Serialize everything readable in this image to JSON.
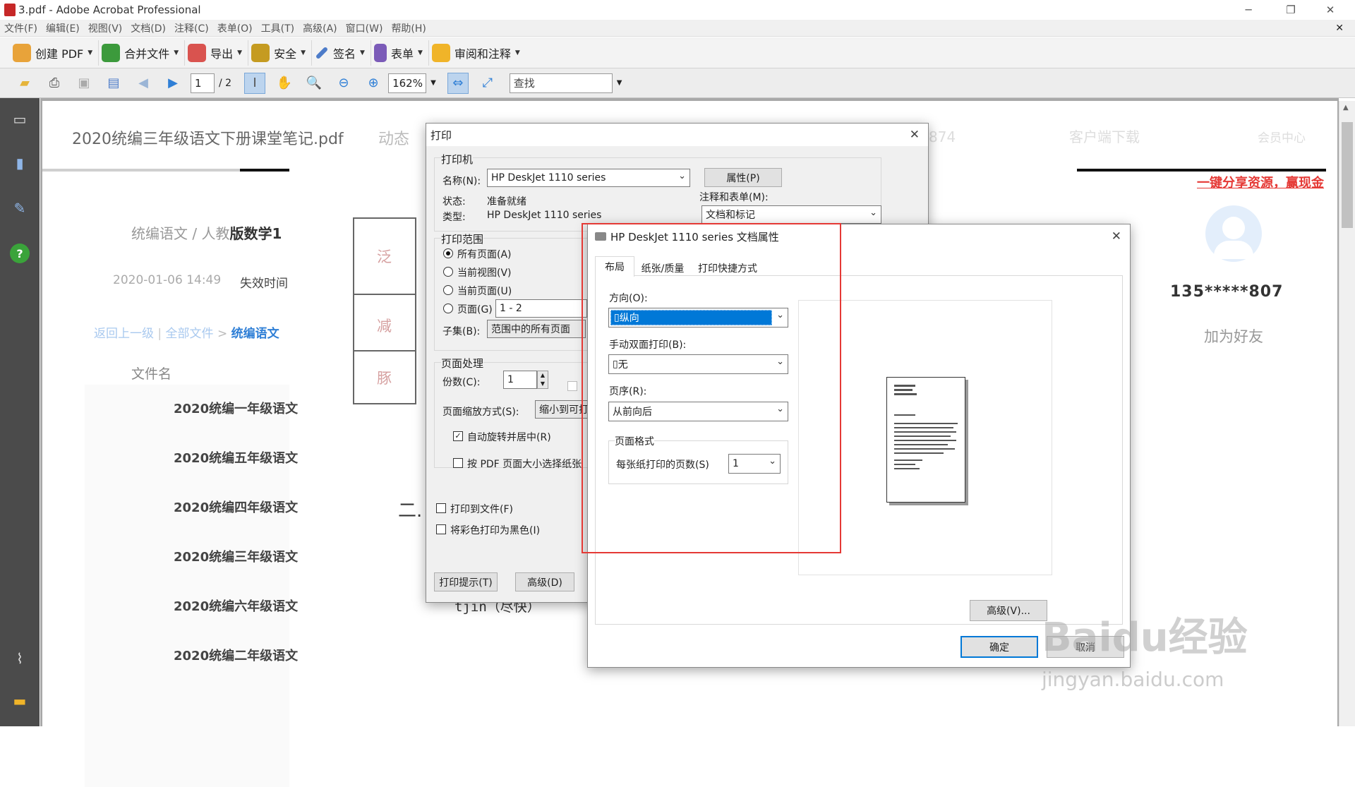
{
  "window": {
    "title": "3.pdf - Adobe Acrobat Professional"
  },
  "menu": [
    "文件(F)",
    "编辑(E)",
    "视图(V)",
    "文档(D)",
    "注释(C)",
    "表单(O)",
    "工具(T)",
    "高级(A)",
    "窗口(W)",
    "帮助(H)"
  ],
  "toolbar1": [
    {
      "label": "创建 PDF",
      "icon": "create-pdf-icon",
      "color": "#e8a33a"
    },
    {
      "label": "合并文件",
      "icon": "combine-files-icon",
      "color": "#3c9a3c"
    },
    {
      "label": "导出",
      "icon": "export-icon",
      "color": "#d9534f"
    },
    {
      "label": "安全",
      "icon": "lock-icon",
      "color": "#c59b21"
    },
    {
      "label": "签名",
      "icon": "pen-icon",
      "color": "#4d7cc9"
    },
    {
      "label": "表单",
      "icon": "form-icon",
      "color": "#7b5bb8"
    },
    {
      "label": "审阅和注释",
      "icon": "comment-icon",
      "color": "#f0b429"
    }
  ],
  "toolbar2": {
    "page_current": "1",
    "page_total": "/ 2",
    "zoom": "162%",
    "search_placeholder": "查找"
  },
  "webpage": {
    "doc_title": "2020统编三年级语文下册课堂笔记.pdf",
    "nav1": "动态",
    "tag": "统编语文 / 人教",
    "tag_bold": "版数学1",
    "date": "2020-01-06 14:49",
    "expire": "失效时间",
    "crumb_back": "返回上一级",
    "crumb_all": "全部文件",
    "crumb_sep": ">",
    "crumb_cur": "统编语文",
    "col_name": "文件名",
    "files": [
      "2020统编一年级语文",
      "2020统编五年级语文",
      "2020统编四年级语文",
      "2020统编三年级语文",
      "2020统编六年级语文",
      "2020统编二年级语文"
    ],
    "share_link": "一键分享资源，赢现金",
    "user_id": "135*****807",
    "add_friend": "加为好友",
    "faded_right": [
      "双874",
      "客户端下载",
      "会员中心"
    ],
    "stamps": [
      "泛",
      "减",
      "豚"
    ],
    "pdf_heading": "二.",
    "pdf_text": "tjin（尽快）"
  },
  "print_dialog": {
    "title": "打印",
    "printer_group": "打印机",
    "name_label": "名称(N):",
    "name_value": "HP DeskJet 1110 series",
    "properties_button": "属性(P)",
    "status_label": "状态:",
    "status_value": "准备就绪",
    "type_label": "类型:",
    "type_value": "HP DeskJet 1110 series",
    "comments_label": "注释和表单(M):",
    "comments_value": "文档和标记",
    "range_group": "打印范围",
    "range_all": "所有页面(A)",
    "range_view": "当前视图(V)",
    "range_current": "当前页面(U)",
    "range_pages": "页面(G)",
    "range_pages_value": "1 - 2",
    "subset_label": "子集(B):",
    "subset_value": "范围中的所有页面",
    "handling_group": "页面处理",
    "copies_label": "份数(C):",
    "copies_value": "1",
    "scaling_label": "页面缩放方式(S):",
    "scaling_value": "缩小到可打",
    "auto_rotate": "自动旋转并居中(R)",
    "choose_by_size": "按 PDF 页面大小选择纸张",
    "print_to_file": "打印到文件(F)",
    "print_black": "将彩色打印为黑色(I)",
    "tips_button": "打印提示(T)",
    "advanced_button": "高级(D)"
  },
  "props_dialog": {
    "title": "HP DeskJet 1110 series 文档属性",
    "tabs": [
      "布局",
      "纸张/质量",
      "打印快捷方式"
    ],
    "orientation_label": "方向(O):",
    "orientation_value": "纵向",
    "duplex_label": "手动双面打印(B):",
    "duplex_value": "无",
    "order_label": "页序(R):",
    "order_value": "从前向后",
    "format_group": "页面格式",
    "pps_label": "每张纸打印的页数(S)",
    "pps_value": "1",
    "advanced_button": "高级(V)...",
    "ok_button": "确定",
    "cancel_button": "取消"
  },
  "watermark": {
    "logo": "Baidu经验",
    "url": "jingyan.baidu.com"
  },
  "colors": {
    "highlight": "#e53935",
    "selection": "#0078d7",
    "accent_blue": "#2f7fd6"
  }
}
